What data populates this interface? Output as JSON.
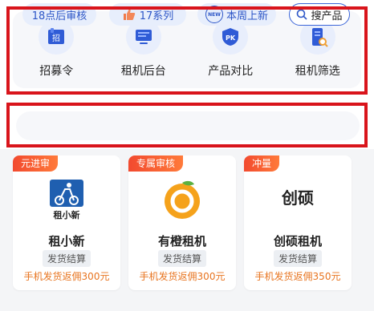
{
  "nav": {
    "items": [
      {
        "label": "招募令",
        "icon": "recruit-icon"
      },
      {
        "label": "租机后台",
        "icon": "monitor-icon"
      },
      {
        "label": "产品对比",
        "icon": "pk-shield-icon"
      },
      {
        "label": "租机筛选",
        "icon": "phone-search-icon"
      }
    ]
  },
  "filters": {
    "chip1": "18点后审核",
    "chip2": "17系列",
    "chip3": "本周上新",
    "chip3_badge": "NEW",
    "search": "搜产品"
  },
  "cards": [
    {
      "tag": "元进审",
      "name": "租小新",
      "badge": "发货结算",
      "promo": "手机发货返佣300元",
      "logo_text": "租小新"
    },
    {
      "tag": "专属审核",
      "name": "有橙租机",
      "badge": "发货结算",
      "promo": "手机发货返佣300元"
    },
    {
      "tag": "冲量",
      "name": "创硕租机",
      "badge": "发货结算",
      "promo": "手机发货返佣350元",
      "logo_text": "创硕"
    }
  ],
  "colors": {
    "accent": "#2d56c7",
    "highlight": "#d9141b",
    "promo": "#e8741f",
    "tag": "#f24a2f"
  }
}
